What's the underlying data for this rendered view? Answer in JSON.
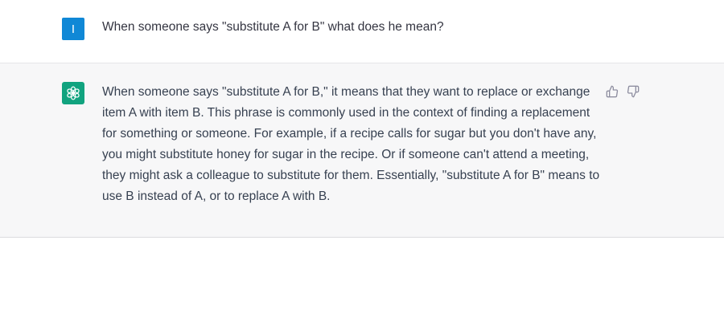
{
  "user_message": {
    "avatar_initial": "I",
    "text": "When someone says \"substitute A for B\" what does he mean?"
  },
  "assistant_message": {
    "avatar_icon": "openai-logo-icon",
    "text": "When someone says \"substitute A for B,\" it means that they want to replace or exchange item A with item B. This phrase is commonly used in the context of finding a replacement for something or someone. For example, if a recipe calls for sugar but you don't have any, you might substitute honey for sugar in the recipe. Or if someone can't attend a meeting, they might ask a colleague to substitute for them. Essentially, \"substitute A for B\" means to use B instead of A, or to replace A with B."
  },
  "feedback": {
    "like_icon": "thumbs-up-icon",
    "dislike_icon": "thumbs-down-icon"
  },
  "colors": {
    "user_avatar": "#1088d6",
    "assistant_avatar": "#11a37f",
    "assistant_row_bg": "#f7f7f8"
  }
}
